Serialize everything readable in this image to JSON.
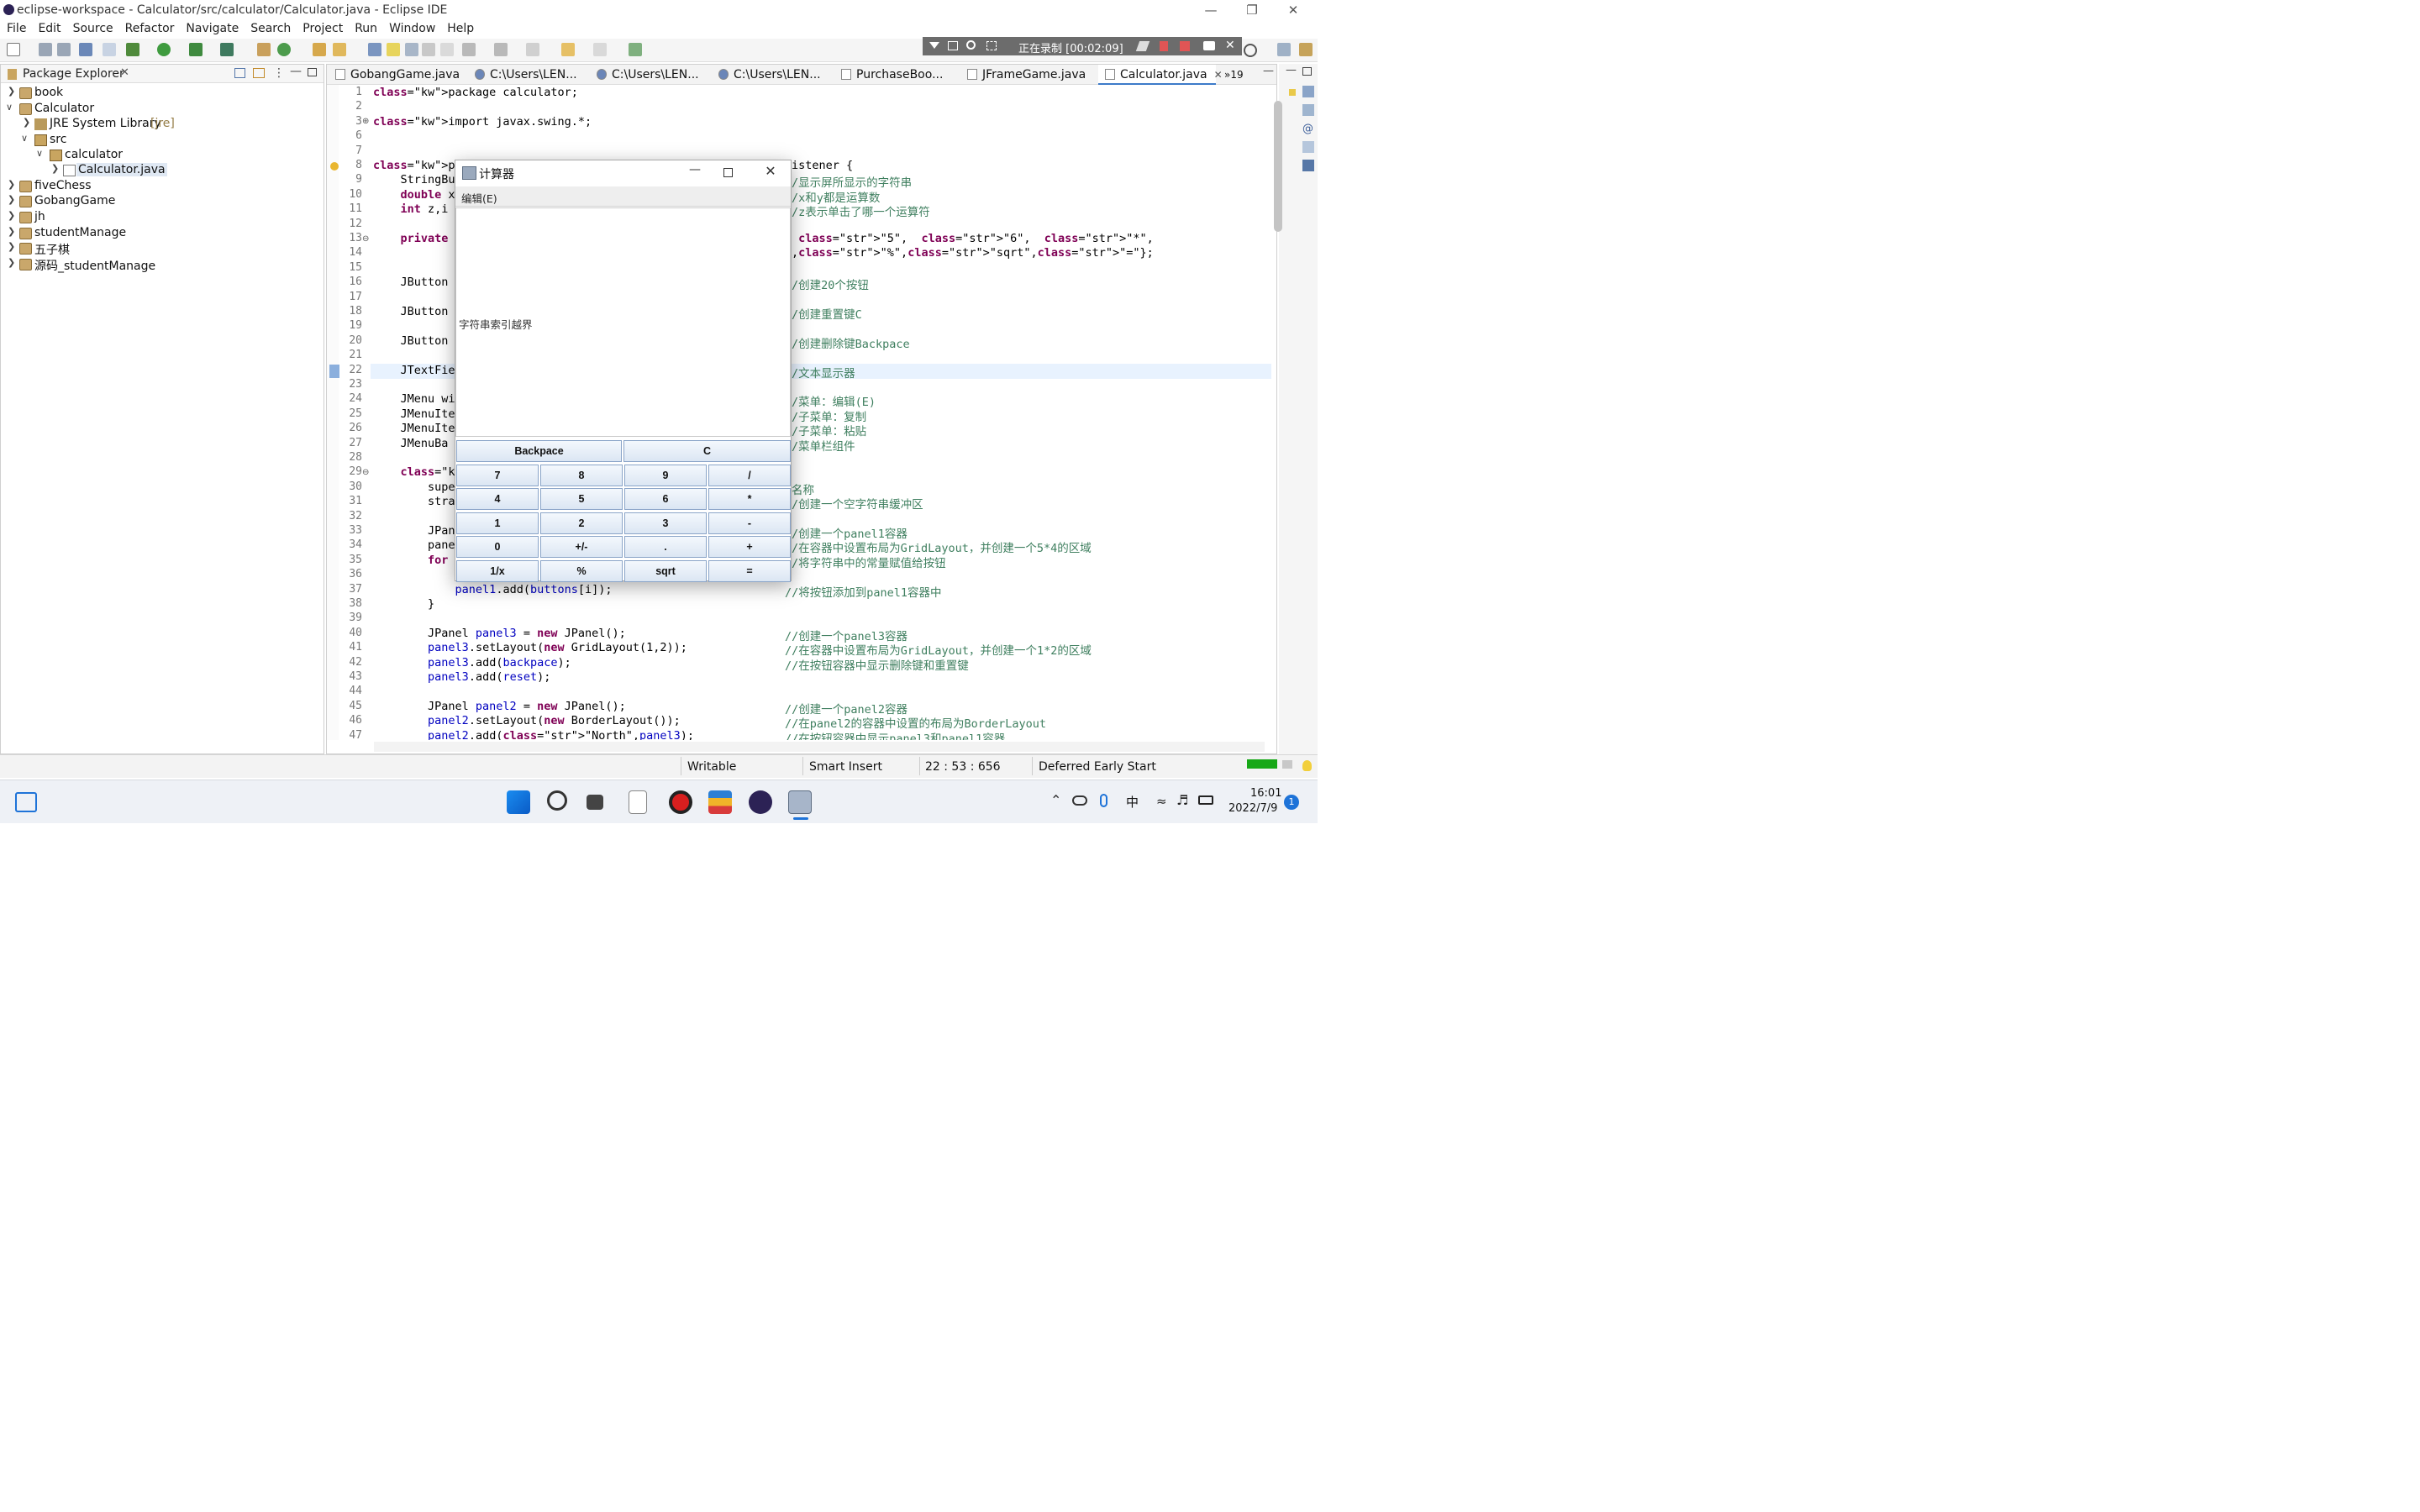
{
  "window": {
    "title": "eclipse-workspace - Calculator/src/calculator/Calculator.java - Eclipse IDE"
  },
  "menubar": [
    "File",
    "Edit",
    "Source",
    "Refactor",
    "Navigate",
    "Search",
    "Project",
    "Run",
    "Window",
    "Help"
  ],
  "recording": {
    "text": "正在录制 [00:02:09]"
  },
  "explorer": {
    "title": "Package Explorer",
    "items": [
      {
        "label": "book",
        "extra": ""
      },
      {
        "label": "Calculator",
        "extra": ""
      },
      {
        "label": "JRE System Library",
        "extra": "[jre]"
      },
      {
        "label": "src",
        "extra": ""
      },
      {
        "label": "calculator",
        "extra": ""
      },
      {
        "label": "Calculator.java",
        "extra": ""
      },
      {
        "label": "fiveChess",
        "extra": ""
      },
      {
        "label": "GobangGame",
        "extra": ""
      },
      {
        "label": "jh",
        "extra": ""
      },
      {
        "label": "studentManage",
        "extra": ""
      },
      {
        "label": "五子棋",
        "extra": ""
      },
      {
        "label": "源码_studentManage",
        "extra": ""
      }
    ]
  },
  "editor_tabs": [
    "GobangGame.java",
    "C:\\Users\\LEN...",
    "C:\\Users\\LEN...",
    "C:\\Users\\LEN...",
    "PurchaseBoo...",
    "JFrameGame.java",
    "Calculator.java"
  ],
  "tabs_overflow": "»19",
  "code_lines": [
    {
      "n": "1",
      "t": "package calculator;"
    },
    {
      "n": "2",
      "t": ""
    },
    {
      "n": "3",
      "t": "import javax.swing.*;"
    },
    {
      "n": "6",
      "t": ""
    },
    {
      "n": "7",
      "t": ""
    },
    {
      "n": "8",
      "t": "public class",
      "r": "istener {"
    },
    {
      "n": "9",
      "t": "    StringBu",
      "r": "/显示屏所显示的字符串"
    },
    {
      "n": "10",
      "t": "    double x",
      "r": "/x和y都是运算数"
    },
    {
      "n": "11",
      "t": "    int z,i",
      "r": "/z表示单击了哪一个运算符"
    },
    {
      "n": "12",
      "t": ""
    },
    {
      "n": "13",
      "t": "    private",
      "r": " \"5\",  \"6\",  \"*\","
    },
    {
      "n": "14",
      "t": "",
      "r": ",\"%\",\"sqrt\",\"=\"};"
    },
    {
      "n": "15",
      "t": ""
    },
    {
      "n": "16",
      "t": "    JButton",
      "r": "/创建20个按钮"
    },
    {
      "n": "17",
      "t": ""
    },
    {
      "n": "18",
      "t": "    JButton",
      "r": "/创建重置键C"
    },
    {
      "n": "19",
      "t": ""
    },
    {
      "n": "20",
      "t": "    JButton",
      "r": "/创建删除键Backpace"
    },
    {
      "n": "21",
      "t": ""
    },
    {
      "n": "22",
      "t": "    JTextFie",
      "r": "/文本显示器"
    },
    {
      "n": "23",
      "t": ""
    },
    {
      "n": "24",
      "t": "    JMenu wi",
      "r": "/菜单：编辑(E)"
    },
    {
      "n": "25",
      "t": "    JMenuIte",
      "r": "/子菜单：复制"
    },
    {
      "n": "26",
      "t": "    JMenuIte",
      "r": "/子菜单：粘贴"
    },
    {
      "n": "27",
      "t": "    JMenuBa",
      "r": "/菜单栏组件"
    },
    {
      "n": "28",
      "t": ""
    },
    {
      "n": "29",
      "t": "    public (",
      "r": ""
    },
    {
      "n": "30",
      "t": "        supe",
      "r": "名称"
    },
    {
      "n": "31",
      "t": "        stra",
      "r": "/创建一个空字符串缓冲区"
    },
    {
      "n": "32",
      "t": ""
    },
    {
      "n": "33",
      "t": "        JPan",
      "r": "/创建一个panel1容器"
    },
    {
      "n": "34",
      "t": "        pane",
      "r": "/在容器中设置布局为GridLayout，并创建一个5*4的区域"
    },
    {
      "n": "35",
      "t": "        for",
      "r": "/将字符串中的常量赋值给按钮"
    },
    {
      "n": "36",
      "t": ""
    },
    {
      "n": "37",
      "t": "            panel1.add(buttons[i]);",
      "r": "//将按钮添加到panel1容器中",
      "rl": true
    },
    {
      "n": "38",
      "t": "        }"
    },
    {
      "n": "39",
      "t": ""
    },
    {
      "n": "40",
      "t": "        JPanel panel3 = new JPanel();",
      "r": "//创建一个panel3容器",
      "rl": true
    },
    {
      "n": "41",
      "t": "        panel3.setLayout(new GridLayout(1,2));",
      "r": "//在容器中设置布局为GridLayout，并创建一个1*2的区域",
      "rl": true
    },
    {
      "n": "42",
      "t": "        panel3.add(backpace);",
      "r": "//在按钮容器中显示删除键和重置键",
      "rl": true
    },
    {
      "n": "43",
      "t": "        panel3.add(reset);"
    },
    {
      "n": "44",
      "t": ""
    },
    {
      "n": "45",
      "t": "        JPanel panel2 = new JPanel();",
      "r": "//创建一个panel2容器",
      "rl": true
    },
    {
      "n": "46",
      "t": "        panel2.setLayout(new BorderLayout());",
      "r": "//在panel2的容器中设置的布局为BorderLayout",
      "rl": true
    },
    {
      "n": "47",
      "t": "        panel2.add(\"North\",panel3);",
      "r": "//在按钮容器中显示panel3和panel1容器",
      "rl": true
    }
  ],
  "calculator": {
    "title": "计算器",
    "menu": "编辑(E)",
    "display": "字符串索引越界",
    "top_buttons": [
      "Backpace",
      "C"
    ],
    "keys": [
      "7",
      "8",
      "9",
      "/",
      "4",
      "5",
      "6",
      "*",
      "1",
      "2",
      "3",
      "-",
      "0",
      "+/-",
      ".",
      "+",
      "1/x",
      "%",
      "sqrt",
      "="
    ]
  },
  "status": {
    "writable": "Writable",
    "insert": "Smart Insert",
    "position": "22 : 53 : 656",
    "task": "Deferred Early Start"
  },
  "taskbar": {
    "time": "16:01",
    "date": "2022/7/9",
    "ime": "中",
    "notifications": "1"
  }
}
